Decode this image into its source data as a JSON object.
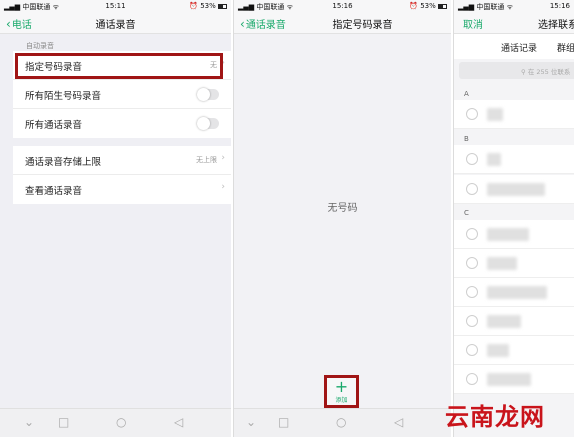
{
  "panel1": {
    "status": {
      "carrier": "中国联通",
      "time": "15:11",
      "battery": "53%"
    },
    "nav": {
      "back_label": "电话",
      "title": "通话录音"
    },
    "section_label": "自动录音",
    "auto_record_rows": [
      {
        "label": "指定号码录音",
        "value": "无"
      },
      {
        "label": "所有陌生号码录音"
      },
      {
        "label": "所有通话录音"
      }
    ],
    "storage_rows": [
      {
        "label": "通话录音存储上限",
        "value": "无上限"
      },
      {
        "label": "查看通话录音"
      }
    ]
  },
  "panel2": {
    "status": {
      "carrier": "中国联通",
      "time": "15:16",
      "battery": "53%"
    },
    "nav": {
      "back_label": "通话录音",
      "title": "指定号码录音"
    },
    "empty_text": "无号码",
    "add": {
      "icon": "plus-icon",
      "label": "添加"
    }
  },
  "panel3": {
    "status": {
      "carrier": "中国联通",
      "time": "15:16"
    },
    "nav": {
      "cancel_label": "取消",
      "title": "选择联系"
    },
    "tabs": [
      "通话记录",
      "群组"
    ],
    "search_placeholder": "在 255 位联系",
    "sections": [
      {
        "letter": "A",
        "count": 1
      },
      {
        "letter": "B",
        "count": 2
      },
      {
        "letter": "C",
        "count": 6
      }
    ]
  },
  "watermark": "云南龙网",
  "colors": {
    "accent": "#1aa96b",
    "highlight": "#a01515"
  }
}
